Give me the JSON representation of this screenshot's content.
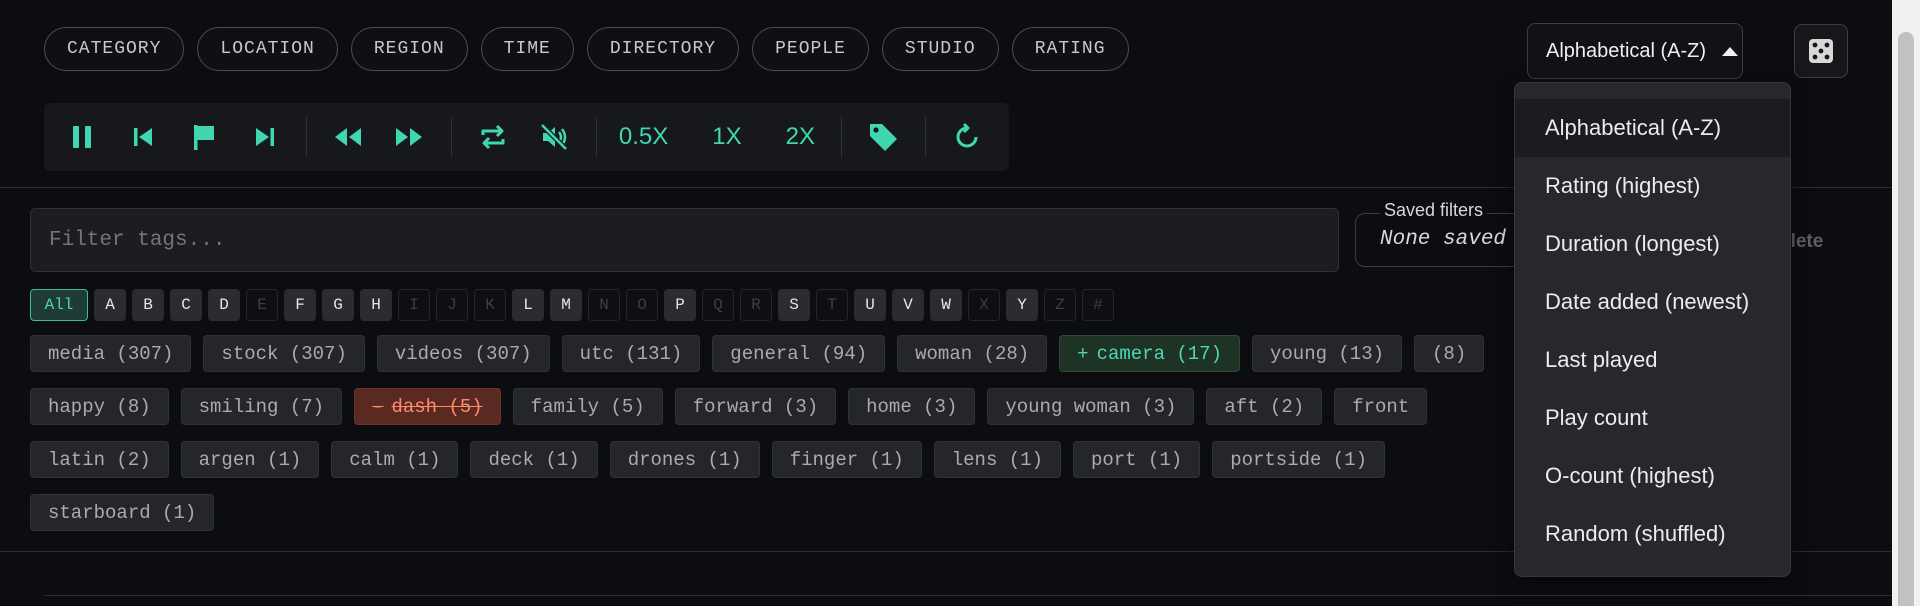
{
  "categories": [
    "CATEGORY",
    "LOCATION",
    "REGION",
    "TIME",
    "DIRECTORY",
    "PEOPLE",
    "STUDIO",
    "RATING"
  ],
  "sort": {
    "selected": "Alphabetical (A-Z)",
    "options": [
      "Alphabetical (A-Z)",
      "Rating (highest)",
      "Duration (longest)",
      "Date added (newest)",
      "Last played",
      "Play count",
      "O-count (highest)",
      "Random (shuffled)"
    ]
  },
  "player": {
    "speeds": [
      "0.5X",
      "1X",
      "2X"
    ],
    "icons": [
      "pause-icon",
      "skip-back-icon",
      "flag-icon",
      "skip-forward-icon",
      "rewind-icon",
      "fast-forward-icon",
      "repeat-icon",
      "mute-icon",
      "tag-icon",
      "refresh-icon"
    ],
    "accent": "#3fd6b0"
  },
  "filter": {
    "placeholder": "Filter tags..."
  },
  "saved_filters": {
    "label": "Saved filters",
    "value": "None saved",
    "delete_label": "elete"
  },
  "letters": [
    {
      "t": "All",
      "s": "active"
    },
    {
      "t": "A",
      "s": "on"
    },
    {
      "t": "B",
      "s": "on"
    },
    {
      "t": "C",
      "s": "on"
    },
    {
      "t": "D",
      "s": "on"
    },
    {
      "t": "E",
      "s": "off"
    },
    {
      "t": "F",
      "s": "on"
    },
    {
      "t": "G",
      "s": "on"
    },
    {
      "t": "H",
      "s": "on"
    },
    {
      "t": "I",
      "s": "off"
    },
    {
      "t": "J",
      "s": "off"
    },
    {
      "t": "K",
      "s": "off"
    },
    {
      "t": "L",
      "s": "on"
    },
    {
      "t": "M",
      "s": "on"
    },
    {
      "t": "N",
      "s": "off"
    },
    {
      "t": "O",
      "s": "off"
    },
    {
      "t": "P",
      "s": "on"
    },
    {
      "t": "Q",
      "s": "off"
    },
    {
      "t": "R",
      "s": "off"
    },
    {
      "t": "S",
      "s": "on"
    },
    {
      "t": "T",
      "s": "off"
    },
    {
      "t": "U",
      "s": "on"
    },
    {
      "t": "V",
      "s": "on"
    },
    {
      "t": "W",
      "s": "on"
    },
    {
      "t": "X",
      "s": "off"
    },
    {
      "t": "Y",
      "s": "on"
    },
    {
      "t": "Z",
      "s": "off"
    },
    {
      "t": "#",
      "s": "off"
    }
  ],
  "tag_rows": [
    [
      {
        "label": "media (307)",
        "state": "none"
      },
      {
        "label": "stock (307)",
        "state": "none"
      },
      {
        "label": "videos (307)",
        "state": "none"
      },
      {
        "label": "utc (131)",
        "state": "none"
      },
      {
        "label": "general (94)",
        "state": "none"
      },
      {
        "label": "woman (28)",
        "state": "none"
      },
      {
        "label": "camera (17)",
        "state": "include",
        "symbol": "+"
      },
      {
        "label": "young (13)",
        "state": "none"
      },
      {
        "label": "(8)",
        "state": "none"
      }
    ],
    [
      {
        "label": "happy (8)",
        "state": "none"
      },
      {
        "label": "smiling (7)",
        "state": "none"
      },
      {
        "label": "dash (5)",
        "state": "exclude",
        "symbol": "-"
      },
      {
        "label": "family (5)",
        "state": "none"
      },
      {
        "label": "forward (3)",
        "state": "none"
      },
      {
        "label": "home (3)",
        "state": "none"
      },
      {
        "label": "young woman (3)",
        "state": "none"
      },
      {
        "label": "aft (2)",
        "state": "none"
      },
      {
        "label": "front",
        "state": "none"
      }
    ],
    [
      {
        "label": "latin (2)",
        "state": "none"
      },
      {
        "label": "argen (1)",
        "state": "none"
      },
      {
        "label": "calm (1)",
        "state": "none"
      },
      {
        "label": "deck (1)",
        "state": "none"
      },
      {
        "label": "drones (1)",
        "state": "none"
      },
      {
        "label": "finger (1)",
        "state": "none"
      },
      {
        "label": "lens (1)",
        "state": "none"
      },
      {
        "label": "port (1)",
        "state": "none"
      },
      {
        "label": "portside (1)",
        "state": "none"
      }
    ],
    [
      {
        "label": "starboard (1)",
        "state": "none"
      }
    ]
  ]
}
